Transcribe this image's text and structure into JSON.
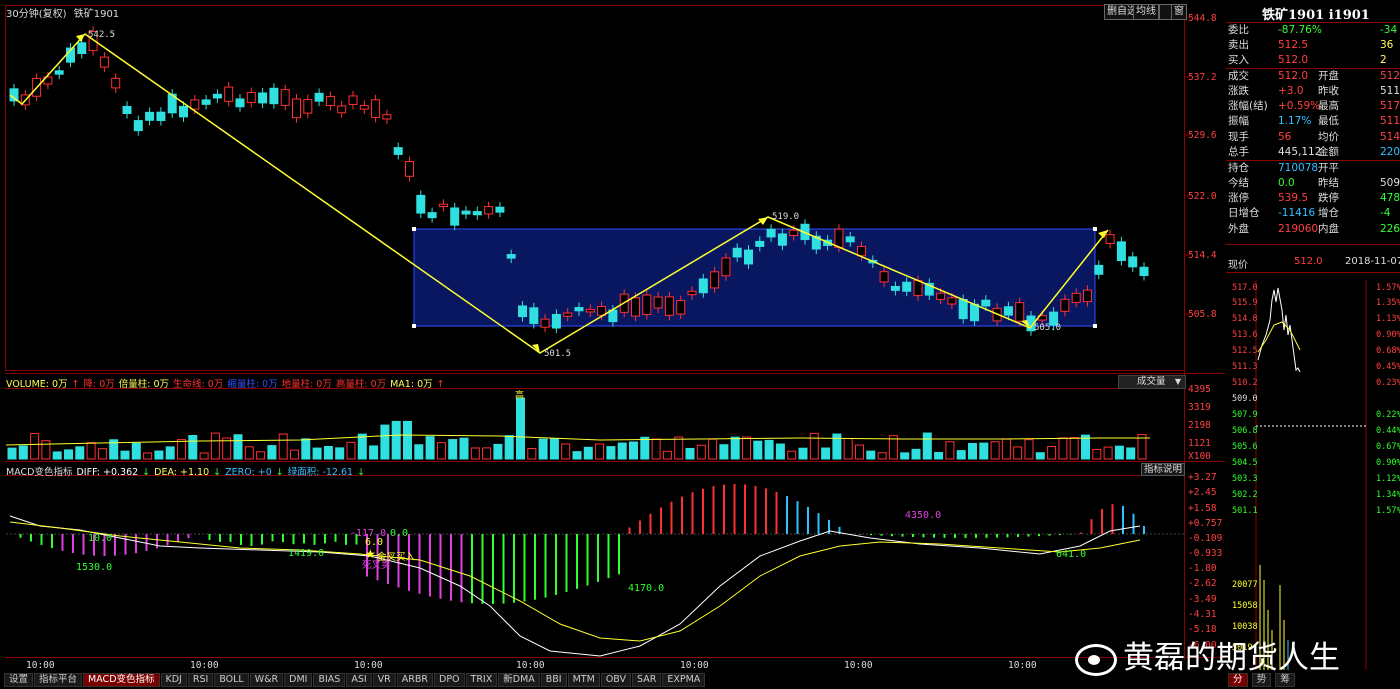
{
  "title": {
    "period": "30分钟(复权)",
    "name": "铁矿1901"
  },
  "toolbar": [
    "删自选",
    "均线",
    "",
    "窗"
  ],
  "price_axis": [
    "544.8",
    "537.2",
    "529.6",
    "522.0",
    "514.4",
    "505.8"
  ],
  "annotations": {
    "high": "542.5",
    "low": "501.5",
    "mid_high": "519.0",
    "mid_low": "505.0"
  },
  "volume": {
    "legend": [
      {
        "text": "VOLUME: 0万",
        "color": "#ffff55"
      },
      {
        "text": "↑",
        "color": "#ff3030"
      },
      {
        "text": "降: 0万",
        "color": "#ff3030"
      },
      {
        "text": "倍量柱: 0万",
        "color": "#ffff55"
      },
      {
        "text": "生命线: 0万",
        "color": "#ff3030"
      },
      {
        "text": "缩量柱: 0万",
        "color": "#3050ff"
      },
      {
        "text": "地量柱: 0万",
        "color": "#ff3030"
      },
      {
        "text": "高量柱: 0万",
        "color": "#ff3030"
      },
      {
        "text": "MA1: 0万",
        "color": "#ffff55"
      },
      {
        "text": "↑",
        "color": "#ff3030"
      }
    ],
    "dropdown": "成交量",
    "axis": [
      "4395",
      "3319",
      "2198",
      "1121",
      "X100"
    ],
    "high_marker": "高"
  },
  "macd": {
    "legend": [
      {
        "text": "MACD变色指标",
        "color": "#dddddd"
      },
      {
        "text": "DIFF: +0.362",
        "color": "#ffffff"
      },
      {
        "text": "↓",
        "color": "#30ff30"
      },
      {
        "text": "DEA: +1.10",
        "color": "#ffff55"
      },
      {
        "text": "↓",
        "color": "#30ff30"
      },
      {
        "text": "ZERO: +0",
        "color": "#30c0ff"
      },
      {
        "text": "↓",
        "color": "#30ff30"
      },
      {
        "text": "绿面积: -12.61",
        "color": "#30c0ff"
      },
      {
        "text": "↓",
        "color": "#30ff30"
      }
    ],
    "help": "指标说明",
    "axis": [
      "+3.27",
      "+2.45",
      "+1.58",
      "+0.757",
      "-0.109",
      "-0.933",
      "-1.80",
      "-2.62",
      "-3.49",
      "-4.31",
      "-5.18",
      "-6.00"
    ],
    "labels": {
      "a": "10.0",
      "b": "1530.0",
      "c": "1419.0",
      "d": "-117.0",
      "e": "0.0",
      "f": "6.0",
      "g": "金叉买入",
      "h": "死叉卖",
      "i": "4170.0",
      "j": "4350.0",
      "k": "641.0"
    }
  },
  "time_axis": [
    "10:00",
    "10:00",
    "10:00",
    "10:00",
    "10:00",
    "10:00",
    "10:00"
  ],
  "tabs": [
    "设置",
    "指标平台",
    "MACD变色指标",
    "KDJ",
    "RSI",
    "BOLL",
    "W&R",
    "DMI",
    "BIAS",
    "ASI",
    "VR",
    "ARBR",
    "DPO",
    "TRIX",
    "新DMA",
    "BBI",
    "MTM",
    "OBV",
    "SAR",
    "EXPMA"
  ],
  "active_tab": "MACD变色指标",
  "quote": {
    "header": "铁矿1901 i1901",
    "rows": [
      {
        "l1": "委比",
        "v1": "-87.76%",
        "c1": "#30ff30",
        "l2": "",
        "v2": "-34",
        "c2": "#30ff30"
      },
      {
        "l1": "卖出",
        "v1": "512.5",
        "c1": "#ff4040",
        "l2": "",
        "v2": "36",
        "c2": "#ffff55"
      },
      {
        "l1": "买入",
        "v1": "512.0",
        "c1": "#ff4040",
        "l2": "",
        "v2": "2",
        "c2": "#ffff55"
      },
      {
        "l1": "成交",
        "v1": "512.0",
        "c1": "#ff4040",
        "l2": "开盘",
        "v2": "512",
        "c2": "#ff4040"
      },
      {
        "l1": "涨跌",
        "v1": "+3.0",
        "c1": "#ff4040",
        "l2": "昨收",
        "v2": "511",
        "c2": "#dddddd"
      },
      {
        "l1": "涨幅(结)",
        "v1": "+0.59%",
        "c1": "#ff4040",
        "l2": "最高",
        "v2": "517",
        "c2": "#ff4040"
      },
      {
        "l1": "振幅",
        "v1": "1.17%",
        "c1": "#30c0ff",
        "l2": "最低",
        "v2": "511",
        "c2": "#ff4040"
      },
      {
        "l1": "现手",
        "v1": "56",
        "c1": "#ff4040",
        "l2": "均价",
        "v2": "514",
        "c2": "#ff4040"
      },
      {
        "l1": "总手",
        "v1": "445,112",
        "c1": "#dddddd",
        "l2": "金额",
        "v2": "220.9",
        "c2": "#30c0ff"
      },
      {
        "l1": "持仓",
        "v1": "710078",
        "c1": "#30c0ff",
        "l2": "开平",
        "v2": "",
        "c2": "#dddddd"
      },
      {
        "l1": "今结",
        "v1": "0.0",
        "c1": "#30ff30",
        "l2": "昨结",
        "v2": "509",
        "c2": "#dddddd"
      },
      {
        "l1": "涨停",
        "v1": "539.5",
        "c1": "#ff4040",
        "l2": "跌停",
        "v2": "478",
        "c2": "#30ff30"
      },
      {
        "l1": "日增仓",
        "v1": "-11416",
        "c1": "#30c0ff",
        "l2": "增仓",
        "v2": "-4",
        "c2": "#30ff30"
      },
      {
        "l1": "外盘",
        "v1": "219060",
        "c1": "#ff4040",
        "l2": "内盘",
        "v2": "22605",
        "c2": "#30ff30"
      }
    ],
    "now_label": "现价",
    "now_value": "512.0",
    "now_date": "2018-11-07",
    "mini_left": [
      "517.0",
      "515.9",
      "514.8",
      "513.6",
      "512.5",
      "511.3",
      "510.2",
      "509.0",
      "507.9",
      "506.8",
      "505.6",
      "504.5",
      "503.3",
      "502.2",
      "501.1"
    ],
    "mini_right": [
      "1.57%",
      "1.35%",
      "1.13%",
      "0.90%",
      "0.68%",
      "0.45%",
      "0.23%",
      "",
      "0.22%",
      "0.44%",
      "0.67%",
      "0.90%",
      "1.12%",
      "1.34%",
      "1.57%"
    ],
    "mini_vol": [
      "20077",
      "15058",
      "10038",
      "5019"
    ],
    "bottom_tabs": [
      "分",
      "势",
      "筹"
    ]
  },
  "watermark": "黄磊的期货人生"
}
